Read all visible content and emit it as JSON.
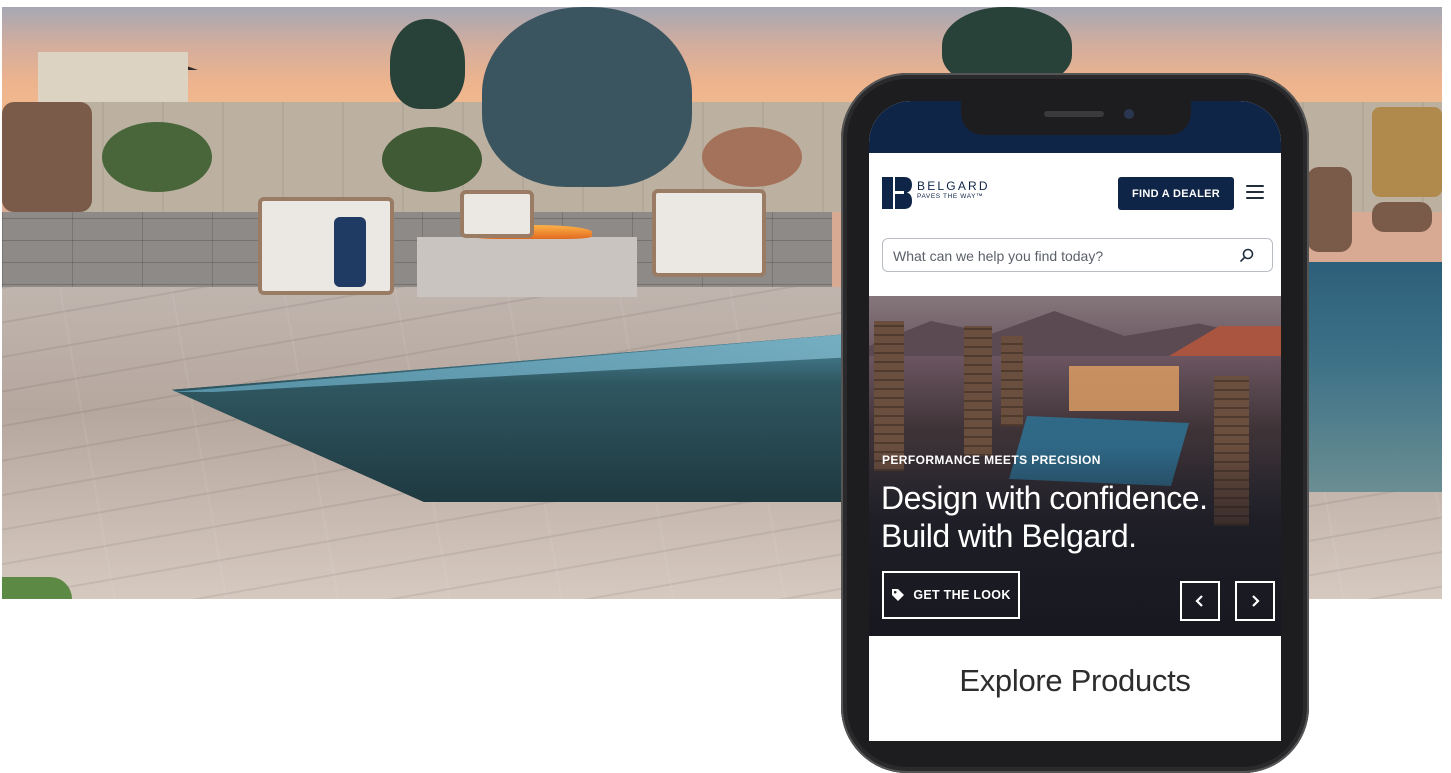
{
  "site": {
    "logo_name": "BELGARD",
    "logo_tagline": "PAVES THE WAY™",
    "find_dealer_label": "FIND A DEALER",
    "search_placeholder": "What can we help you find today?"
  },
  "hero": {
    "eyebrow": "PERFORMANCE MEETS PRECISION",
    "headline": "Design with confidence. Build with Belgard.",
    "cta_label": "GET THE LOOK",
    "prev_icon": "chevron-left-icon",
    "next_icon": "chevron-right-icon"
  },
  "section": {
    "title": "Explore Products"
  },
  "colors": {
    "brand_navy": "#0f2547",
    "white": "#ffffff"
  }
}
